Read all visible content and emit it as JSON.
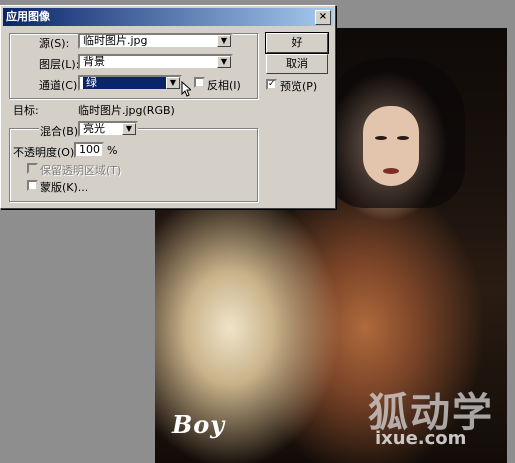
{
  "dialog": {
    "title": "应用图像",
    "close": "×",
    "source": {
      "label": "源(S):",
      "value": "临时图片.jpg"
    },
    "layer": {
      "label": "图层(L):",
      "value": "背景"
    },
    "channel": {
      "label": "通道(C):",
      "value": "绿"
    },
    "invert": {
      "label": "反相(I)",
      "checked": false
    },
    "target": {
      "label": "目标:",
      "value": "临时图片.jpg(RGB)"
    },
    "blending": {
      "label": "混合(B):",
      "value": "亮光"
    },
    "opacity": {
      "label": "不透明度(O):",
      "value": "100",
      "unit": "%"
    },
    "preserve_transparency": {
      "label": "保留透明区域(T)",
      "checked": false,
      "disabled": true
    },
    "mask": {
      "label": "蒙版(K)...",
      "checked": false
    },
    "ok": "好",
    "cancel": "取消",
    "preview": {
      "label": "预览(P)",
      "checked": true
    }
  },
  "watermarks": {
    "left": "Boy",
    "right": "狐动学",
    "url": "ixue.com"
  },
  "icons": [
    "close-icon",
    "dropdown-arrow-icon",
    "checkmark-icon",
    "mouse-pointer-icon"
  ]
}
